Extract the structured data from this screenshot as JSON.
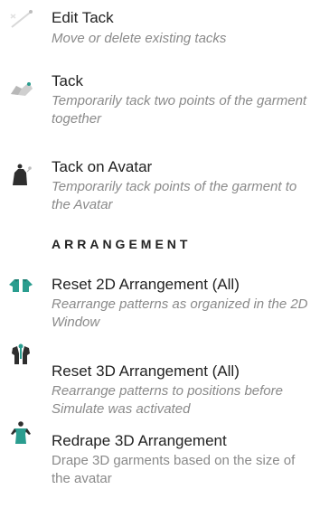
{
  "menu": {
    "items": [
      {
        "label": "Edit Tack",
        "description": "Move or delete existing tacks",
        "icon": "edit-tack-icon"
      },
      {
        "label": "Tack",
        "description": "Temporarily tack two points of the garment together",
        "icon": "tack-icon"
      },
      {
        "label": "Tack on Avatar",
        "description": "Temporarily tack points of the garment to the Avatar",
        "icon": "tack-on-avatar-icon"
      }
    ]
  },
  "arrangement": {
    "header": "ARRANGEMENT",
    "items": [
      {
        "label": "Reset 2D Arrangement (All)",
        "description": "Rearrange patterns as organized in the 2D Window",
        "icon": "reset-2d-arrangement-icon"
      },
      {
        "label": "Reset 3D Arrangement (All)",
        "description": "Rearrange patterns to positions before Simulate was activated",
        "icon": "reset-3d-arrangement-icon"
      },
      {
        "label": "Redrape 3D Arrangement",
        "description": "Drape 3D garments based on the size of the avatar",
        "icon": "redrape-3d-arrangement-icon"
      }
    ]
  },
  "colors": {
    "text": "#222222",
    "description": "#8a8a8a",
    "icon_dark": "#2e2e2e",
    "icon_teal": "#2a9d8f",
    "icon_light": "#c9c9c9"
  }
}
